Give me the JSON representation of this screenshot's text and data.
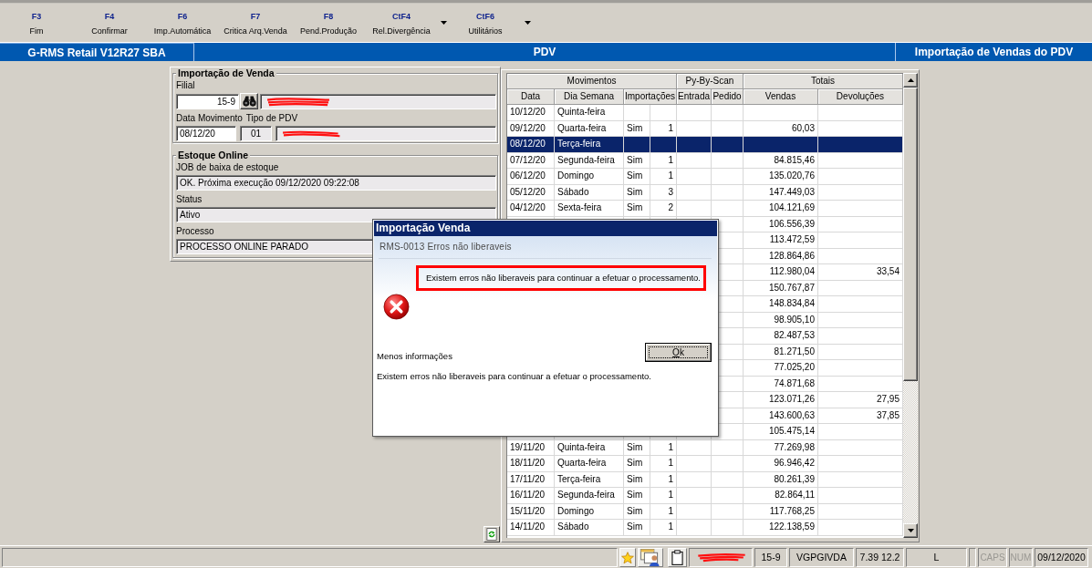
{
  "toolbar": {
    "buttons": [
      {
        "key": "F3",
        "label": "Fim",
        "dropdown": false
      },
      {
        "key": "F4",
        "label": "Confirmar",
        "dropdown": false
      },
      {
        "key": "F6",
        "label": "Imp.Automática",
        "dropdown": false
      },
      {
        "key": "F7",
        "label": "Critica Arq.Venda",
        "dropdown": false
      },
      {
        "key": "F8",
        "label": "Pend.Produção",
        "dropdown": false
      },
      {
        "key": "CtF4",
        "label": "Rel.Divergência",
        "dropdown": true
      },
      {
        "key": "CtF6",
        "label": "Utilitários",
        "dropdown": true
      }
    ]
  },
  "title_bar": {
    "app": "G-RMS Retail V12R27 SBA",
    "module": "PDV",
    "screen": "Importação de Vendas do PDV"
  },
  "importacao_de_venda": {
    "title": "Importação de Venda",
    "filial": {
      "label": "Filial",
      "value": "15-9"
    },
    "data_movimento": {
      "label": "Data Movimento",
      "value": "08/12/20"
    },
    "tipo_de_pdv": {
      "label": "Tipo de PDV",
      "value": "01"
    }
  },
  "estoque_online": {
    "title": "Estoque Online",
    "fields": [
      {
        "label": "JOB de baixa de estoque",
        "value": "OK. Próxima execução 09/12/2020 09:22:08"
      },
      {
        "label": "Status",
        "value": "Ativo"
      },
      {
        "label": "Processo",
        "value": "PROCESSO ONLINE PARADO"
      }
    ]
  },
  "table": {
    "group_headers": [
      "Movimentos",
      "Py-By-Scan",
      "Totais"
    ],
    "columns": [
      "Data",
      "Dia Semana",
      "Importações",
      "Entrada",
      "Pedido",
      "Vendas",
      "Devoluções"
    ],
    "rows": [
      {
        "data": "10/12/20",
        "dia": "Quinta-feira",
        "selected": false
      },
      {
        "data": "09/12/20",
        "dia": "Quarta-feira",
        "importada": "Sim",
        "quantidade": "1",
        "vendas": "60,03",
        "selected": false
      },
      {
        "data": "08/12/20",
        "dia": "Terça-feira",
        "selected": true
      },
      {
        "data": "07/12/20",
        "dia": "Segunda-feira",
        "importada": "Sim",
        "quantidade": "1",
        "vendas": "84.815,46",
        "selected": false
      },
      {
        "data": "06/12/20",
        "dia": "Domingo",
        "importada": "Sim",
        "quantidade": "1",
        "vendas": "135.020,76",
        "selected": false
      },
      {
        "data": "05/12/20",
        "dia": "Sábado",
        "importada": "Sim",
        "quantidade": "3",
        "vendas": "147.449,03",
        "selected": false
      },
      {
        "data": "04/12/20",
        "dia": "Sexta-feira",
        "importada": "Sim",
        "quantidade": "2",
        "vendas": "104.121,69",
        "selected": false
      },
      {
        "vendas": "106.556,39",
        "selected": false
      },
      {
        "vendas": "113.472,59",
        "selected": false
      },
      {
        "vendas": "128.864,86",
        "selected": false
      },
      {
        "vendas": "112.980,04",
        "devolucoes": "33,54",
        "selected": false
      },
      {
        "vendas": "150.767,87",
        "selected": false
      },
      {
        "vendas": "148.834,84",
        "selected": false
      },
      {
        "vendas": "98.905,10",
        "selected": false
      },
      {
        "vendas": "82.487,53",
        "selected": false
      },
      {
        "vendas": "81.271,50",
        "selected": false
      },
      {
        "vendas": "77.025,20",
        "selected": false
      },
      {
        "vendas": "74.871,68",
        "selected": false
      },
      {
        "vendas": "123.071,26",
        "devolucoes": "27,95",
        "selected": false
      },
      {
        "vendas": "143.600,63",
        "devolucoes": "37,85",
        "selected": false
      },
      {
        "vendas": "105.475,14",
        "selected": false
      },
      {
        "data": "19/11/20",
        "dia": "Quinta-feira",
        "importada": "Sim",
        "quantidade": "1",
        "vendas": "77.269,98",
        "selected": false
      },
      {
        "data": "18/11/20",
        "dia": "Quarta-feira",
        "importada": "Sim",
        "quantidade": "1",
        "vendas": "96.946,42",
        "selected": false
      },
      {
        "data": "17/11/20",
        "dia": "Terça-feira",
        "importada": "Sim",
        "quantidade": "1",
        "vendas": "80.261,39",
        "selected": false
      },
      {
        "data": "16/11/20",
        "dia": "Segunda-feira",
        "importada": "Sim",
        "quantidade": "1",
        "vendas": "82.864,11",
        "selected": false
      },
      {
        "data": "15/11/20",
        "dia": "Domingo",
        "importada": "Sim",
        "quantidade": "1",
        "vendas": "117.768,25",
        "selected": false
      },
      {
        "data": "14/11/20",
        "dia": "Sábado",
        "importada": "Sim",
        "quantidade": "1",
        "vendas": "122.138,59",
        "selected": false
      }
    ]
  },
  "dialog": {
    "title": "Importação Venda",
    "code": "RMS-0013 Erros não liberaveis",
    "message": "Existem erros não liberaveis para continuar a efetuar o processamento.",
    "highlighted": true,
    "ok_button": "Ok",
    "details_toggle": "Menos informações",
    "details": "Existem erros não liberaveis para continuar a efetuar o processamento."
  },
  "status_bar": {
    "fields": [
      "15-9",
      "VGPGIVDA",
      "7.39 12.2",
      "L"
    ],
    "indicators": [
      {
        "label": "CAPS",
        "on": false
      },
      {
        "label": "NUM",
        "on": false
      }
    ],
    "date": "09/12/2020"
  }
}
